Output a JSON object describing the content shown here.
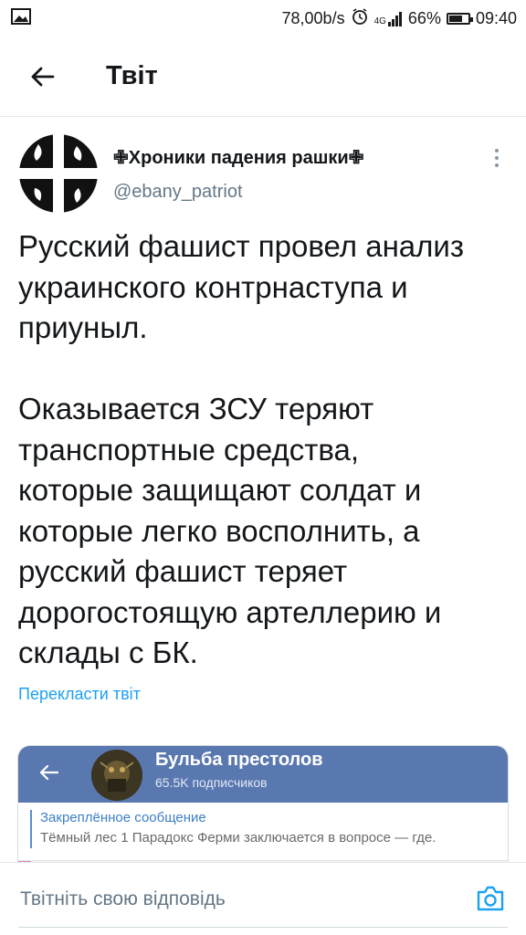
{
  "status_bar": {
    "gallery_icon": "image-icon",
    "net_speed": "78,00b/s",
    "alarm_icon": "alarm-icon",
    "network": "4G",
    "battery": "66%",
    "battery_level": 0.66,
    "time": "09:40"
  },
  "header": {
    "title": "Твіт"
  },
  "tweet": {
    "author_name": "✙Хроники падения рашки✙",
    "author_handle": "@ebany_patriot",
    "paragraphs": [
      [
        "Русский фашист провел анализ",
        "украинского контрнаступа и",
        "приуныл."
      ],
      [
        "Оказывается ЗСУ теряют",
        "транспортные средства,",
        "которые защищают солдат и",
        "которые легко восполнить, а",
        "русский фашист теряет",
        "дорогостоящую артеллерию и",
        "склады с БК."
      ]
    ],
    "translate_label": "Перекласти твіт"
  },
  "media": {
    "channel_title": "Бульба престолов",
    "subscribers": "65.5K подписчиков",
    "pinned_label": "Закреплённое сообщение",
    "pinned_text": "Тёмный лес 1  Парадокс Ферми заключается в вопросе — где."
  },
  "reply": {
    "placeholder": "Твітніть свою відповідь"
  },
  "colors": {
    "accent": "#1da1f2",
    "telegram_header": "#5a78b0",
    "secondary_text": "#657786"
  }
}
